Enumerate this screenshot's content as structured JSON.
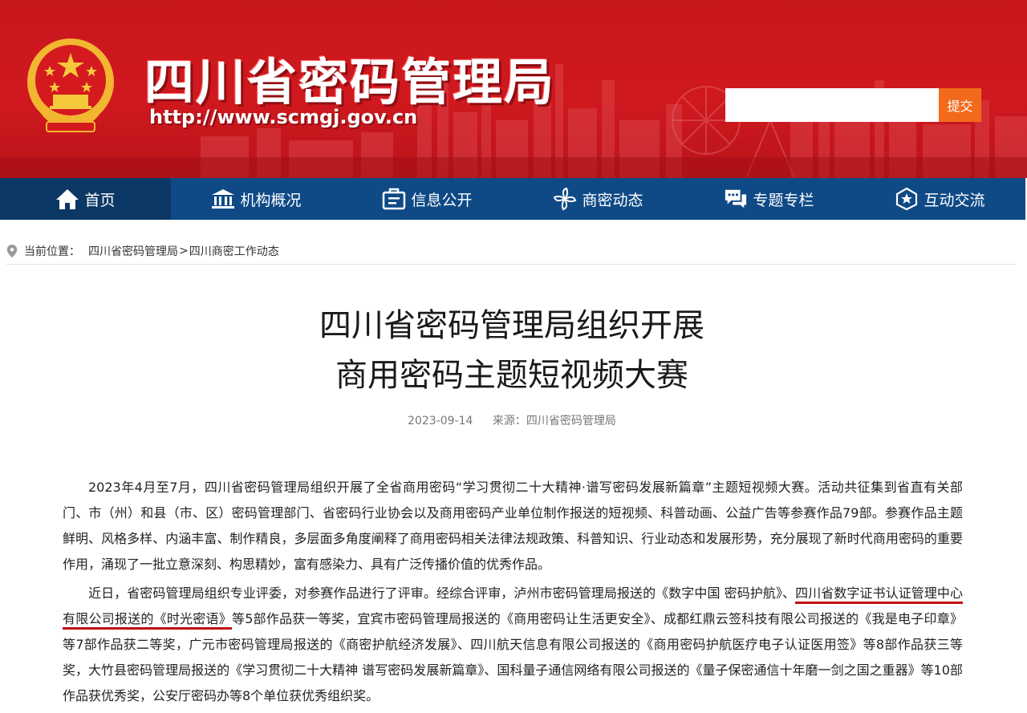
{
  "header": {
    "site_title": "四川省密码管理局",
    "site_url": "http://www.scmgj.gov.cn",
    "search_placeholder": "",
    "search_button": "提交"
  },
  "nav": {
    "items": [
      {
        "label": "首页",
        "icon": "home-icon",
        "active": true
      },
      {
        "label": "机构概况",
        "icon": "institution-icon"
      },
      {
        "label": "信息公开",
        "icon": "info-disclosure-icon"
      },
      {
        "label": "商密动态",
        "icon": "pinwheel-icon"
      },
      {
        "label": "专题专栏",
        "icon": "chat-bubble-icon"
      },
      {
        "label": "互动交流",
        "icon": "interaction-icon"
      }
    ]
  },
  "breadcrumb": {
    "label": "当前位置：",
    "items": [
      "四川省密码管理局",
      "四川商密工作动态"
    ],
    "separator": ">"
  },
  "article": {
    "title_line1": "四川省密码管理局组织开展",
    "title_line2": "商用密码主题短视频大赛",
    "date": "2023-09-14",
    "source": "来源：四川省密码管理局",
    "para1": "2023年4月至7月，四川省密码管理局组织开展了全省商用密码“学习贯彻二十大精神·谱写密码发展新篇章”主题短视频大赛。活动共征集到省直有关部门、市（州）和县（市、区）密码管理部门、省密码行业协会以及商用密码产业单位制作报送的短视频、科普动画、公益广告等参赛作品79部。参赛作品主题鲜明、风格多样、内涵丰富、制作精良，多层面多角度阐释了商用密码相关法律法规政策、科普知识、行业动态和发展形势，充分展现了新时代商用密码的重要作用，涌现了一批立意深刻、构思精妙，富有感染力、具有广泛传播价值的优秀作品。",
    "para2_a": "近日，省密码管理局组织专业评委，对参赛作品进行了评审。经综合评审，泸州市密码管理局报送的《数字中国 密码护航》、",
    "para2_highlight": "四川省数字证书认证管理中心有限公司报送的《时光密语》",
    "para2_b": "等5部作品获一等奖，宜宾市密码管理局报送的《商用密码让生活更安全》、成都红鼎云签科技有限公司报送的《我是电子印章》等7部作品获二等奖，广元市密码管理局报送的《商密护航经济发展》、四川航天信息有限公司报送的《商用密码护航医疗电子认证医用签》等8部作品获三等奖，大竹县密码管理局报送的《学习贯彻二十大精神 谱写密码发展新篇章》、国科量子通信网络有限公司报送的《量子保密通信十年磨一剑之国之重器》等10部作品获优秀奖，公安厅密码办等8个单位获优秀组织奖。"
  },
  "colors": {
    "banner_red": "#c8161d",
    "nav_blue": "#0f4a86",
    "nav_active": "#0b3864",
    "search_button": "#f26b1d",
    "highlight_underline": "#c00d14"
  }
}
